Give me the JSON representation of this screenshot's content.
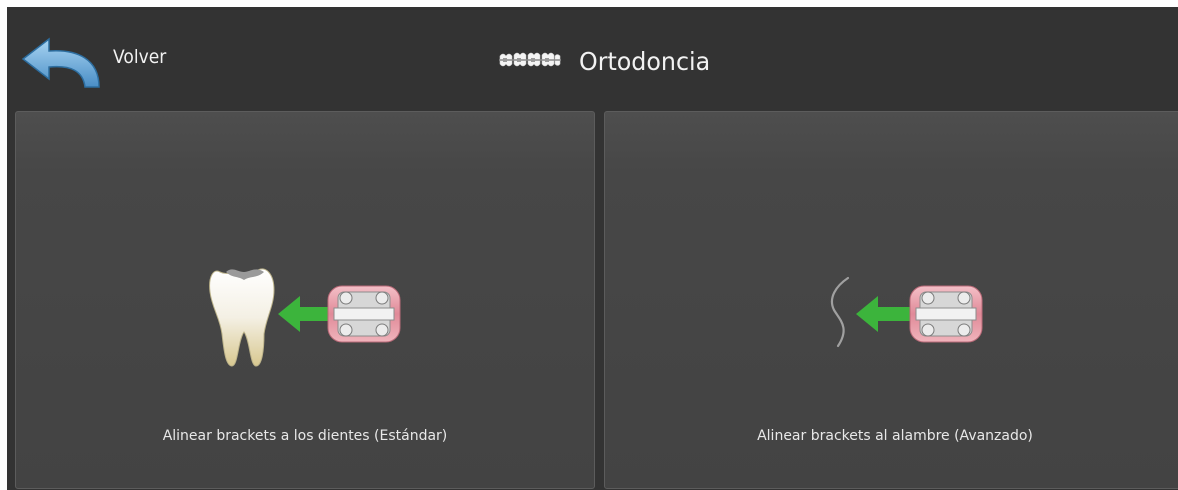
{
  "header": {
    "back_label": "Volver",
    "back_icon": "undo-arrow-icon",
    "title": "Ortodoncia",
    "title_icon": "braces-icon"
  },
  "options": [
    {
      "label": "Alinear brackets a los dientes (Estándar)",
      "icon": "tooth-bracket-align-icon"
    },
    {
      "label": "Alinear brackets al alambre (Avanzado)",
      "icon": "wire-bracket-align-icon"
    }
  ],
  "colors": {
    "background": "#333333",
    "card": "#474747",
    "arrow_green": "#3cb43c",
    "bracket_pink": "#e8a0a8",
    "back_arrow_blue": "#5aa0d2"
  }
}
